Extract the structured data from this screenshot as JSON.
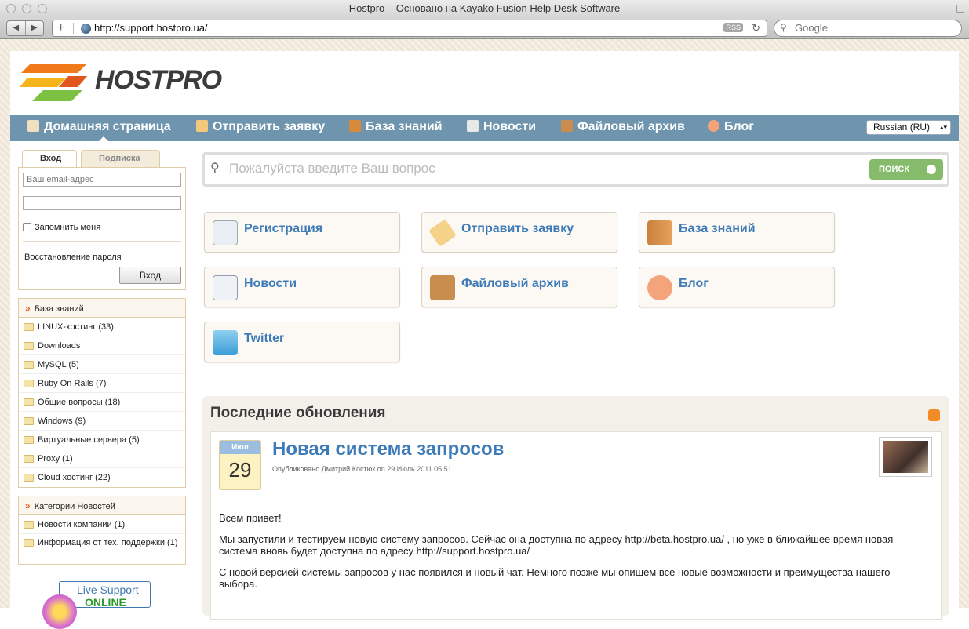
{
  "window": {
    "title": "Hostpro – Основано на Kayako Fusion Help Desk Software"
  },
  "browser": {
    "url": "http://support.hostpro.ua/",
    "rss_label": "RSS",
    "search_placeholder": "Google"
  },
  "site": {
    "logo_text": "HOSTPRO"
  },
  "nav": {
    "items": [
      {
        "label": "Домашняя страница",
        "icon": "home-icon"
      },
      {
        "label": "Отправить заявку",
        "icon": "ticket-icon"
      },
      {
        "label": "База знаний",
        "icon": "books-icon"
      },
      {
        "label": "Новости",
        "icon": "news-icon"
      },
      {
        "label": "Файловый архив",
        "icon": "box-icon"
      },
      {
        "label": "Блог",
        "icon": "blog-icon"
      }
    ],
    "language": "Russian (RU)"
  },
  "login": {
    "tab_login": "Вход",
    "tab_subscribe": "Подписка",
    "email_placeholder": "Ваш email-адрес",
    "remember": "Запомнить меня",
    "recover": "Восстановление пароля",
    "submit": "Вход"
  },
  "kb": {
    "title": "База знаний",
    "items": [
      "LINUX-хостинг (33)",
      "Downloads",
      "MySQL (5)",
      "Ruby On Rails (7)",
      "Общие вопросы (18)",
      "Windows (9)",
      "Виртуальные сервера (5)",
      "Proxy (1)",
      "Cloud хостинг (22)"
    ]
  },
  "news_categories": {
    "title": "Категории Новостей",
    "items": [
      "Новости компании (1)",
      "Информация от тех. поддержки (1)"
    ]
  },
  "live_support": {
    "line1": "Live Support",
    "line2": "ONLINE"
  },
  "search": {
    "placeholder": "Пожалуйста введите Ваш вопрос",
    "button": "ПОИСК"
  },
  "cards": [
    {
      "label": "Регистрация",
      "icon": "registration-icon"
    },
    {
      "label": "Отправить заявку",
      "icon": "ticket-icon"
    },
    {
      "label": "База знаний",
      "icon": "books-icon"
    },
    {
      "label": "Новости",
      "icon": "news-icon"
    },
    {
      "label": "Файловый архив",
      "icon": "box-icon"
    },
    {
      "label": "Блог",
      "icon": "blog-icon"
    },
    {
      "label": "Twitter",
      "icon": "twitter-icon"
    }
  ],
  "updates": {
    "title": "Последние обновления",
    "post": {
      "month": "Июл",
      "day": "29",
      "title": "Новая система запросов",
      "meta": "Опубликовано Дмитрий Костюк on 29 Июль 2011 05:51",
      "p1": "Всем привет!",
      "p2": "Мы запустили и тестируем новую систему запросов. Сейчас она доступна по адресу http://beta.hostpro.ua/ , но уже в ближайшее время новая система вновь будет доступна по адресу http://support.hostpro.ua/",
      "p3": "С новой версией системы запросов у нас появился и новый чат. Немного позже мы опишем все новые возможности и преимущества нашего выбора."
    }
  },
  "colors": {
    "nav_bg": "#6e95ad",
    "link": "#3d7ab8",
    "search_button": "#85bb6b",
    "accent": "#e25c1e"
  }
}
